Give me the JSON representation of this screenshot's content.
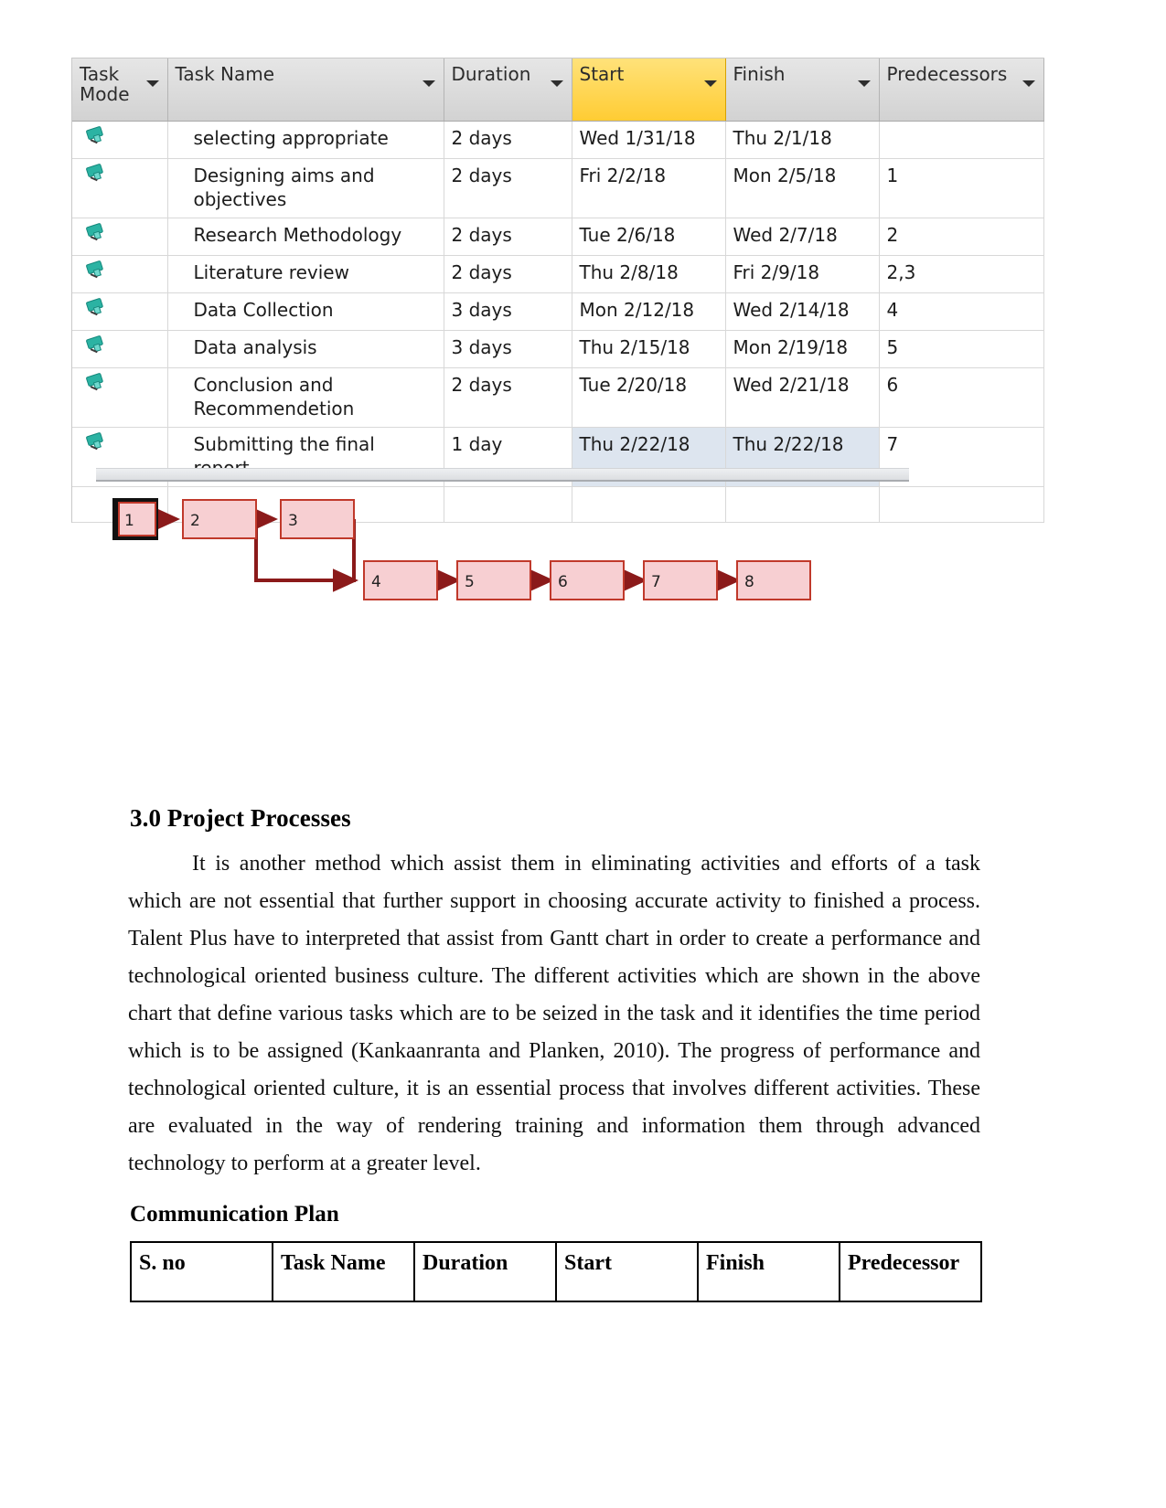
{
  "gantt": {
    "columns": [
      {
        "label": "Task Mode",
        "key": "mode",
        "selected": false,
        "caret": true
      },
      {
        "label": "Task Name",
        "key": "name",
        "selected": false,
        "caret": true
      },
      {
        "label": "Duration",
        "key": "duration",
        "selected": false,
        "caret": true
      },
      {
        "label": "Start",
        "key": "start",
        "selected": true,
        "caret": true
      },
      {
        "label": "Finish",
        "key": "finish",
        "selected": false,
        "caret": true
      },
      {
        "label": "Predecessors",
        "key": "predecessors",
        "selected": false,
        "caret": true
      }
    ],
    "mode_icon": "pushpin-icon",
    "rows": [
      {
        "name": "selecting appropriate",
        "duration": "2 days",
        "start": "Wed 1/31/18",
        "finish": "Thu 2/1/18",
        "predecessors": "",
        "highlight": false
      },
      {
        "name": "Designing aims and objectives",
        "duration": "2 days",
        "start": "Fri 2/2/18",
        "finish": "Mon 2/5/18",
        "predecessors": "1",
        "highlight": false
      },
      {
        "name": "Research Methodology",
        "duration": "2 days",
        "start": "Tue 2/6/18",
        "finish": "Wed 2/7/18",
        "predecessors": "2",
        "highlight": false
      },
      {
        "name": "Literature review",
        "duration": "2 days",
        "start": "Thu 2/8/18",
        "finish": "Fri 2/9/18",
        "predecessors": "2,3",
        "highlight": false
      },
      {
        "name": "Data Collection",
        "duration": "3 days",
        "start": "Mon 2/12/18",
        "finish": "Wed 2/14/18",
        "predecessors": "4",
        "highlight": false
      },
      {
        "name": "Data analysis",
        "duration": "3 days",
        "start": "Thu 2/15/18",
        "finish": "Mon 2/19/18",
        "predecessors": "5",
        "highlight": false
      },
      {
        "name": "Conclusion and Recommendetion",
        "duration": "2 days",
        "start": "Tue 2/20/18",
        "finish": "Wed 2/21/18",
        "predecessors": "6",
        "highlight": false
      },
      {
        "name": "Submitting the final report",
        "duration": "1 day",
        "start": "Thu 2/22/18",
        "finish": "Thu 2/22/18",
        "predecessors": "7",
        "highlight": true
      }
    ]
  },
  "network_diagram": {
    "nodes": [
      {
        "id": "1",
        "label": "1",
        "selected": true
      },
      {
        "id": "2",
        "label": "2",
        "selected": false
      },
      {
        "id": "3",
        "label": "3",
        "selected": false
      },
      {
        "id": "4",
        "label": "4",
        "selected": false
      },
      {
        "id": "5",
        "label": "5",
        "selected": false
      },
      {
        "id": "6",
        "label": "6",
        "selected": false
      },
      {
        "id": "7",
        "label": "7",
        "selected": false
      },
      {
        "id": "8",
        "label": "8",
        "selected": false
      }
    ],
    "edges": [
      {
        "from": "1",
        "to": "2"
      },
      {
        "from": "2",
        "to": "3"
      },
      {
        "from": "2",
        "to": "4"
      },
      {
        "from": "3",
        "to": "4"
      },
      {
        "from": "4",
        "to": "5"
      },
      {
        "from": "5",
        "to": "6"
      },
      {
        "from": "6",
        "to": "7"
      },
      {
        "from": "7",
        "to": "8"
      }
    ],
    "node_fill": "#f7cfd2",
    "node_stroke": "#c0392b",
    "edge_color": "#8b1a1a",
    "selected_stroke": "#000000"
  },
  "headings": {
    "project_processes": "3.0 Project Processes",
    "communication_plan": "Communication Plan"
  },
  "paragraph": "It is another method which assist them in eliminating activities and efforts of a task which are not essential that further support in choosing accurate activity to finished a process. Talent Plus have to interpreted that assist from Gantt chart in order to create a performance and technological oriented business culture. The different activities which are shown in the above chart that define various tasks which are to be seized in the task and it identifies the time period which is to be assigned (Kankaanranta and Planken, 2010). The progress of performance and technological oriented culture, it is an essential process that involves different activities. These are evaluated in the way of rendering training and information them through advanced technology to perform at a greater level.",
  "comm_table": {
    "headers": [
      "S. no",
      "Task Name",
      "Duration",
      "Start",
      "Finish",
      "Predecessor"
    ],
    "rows": []
  }
}
